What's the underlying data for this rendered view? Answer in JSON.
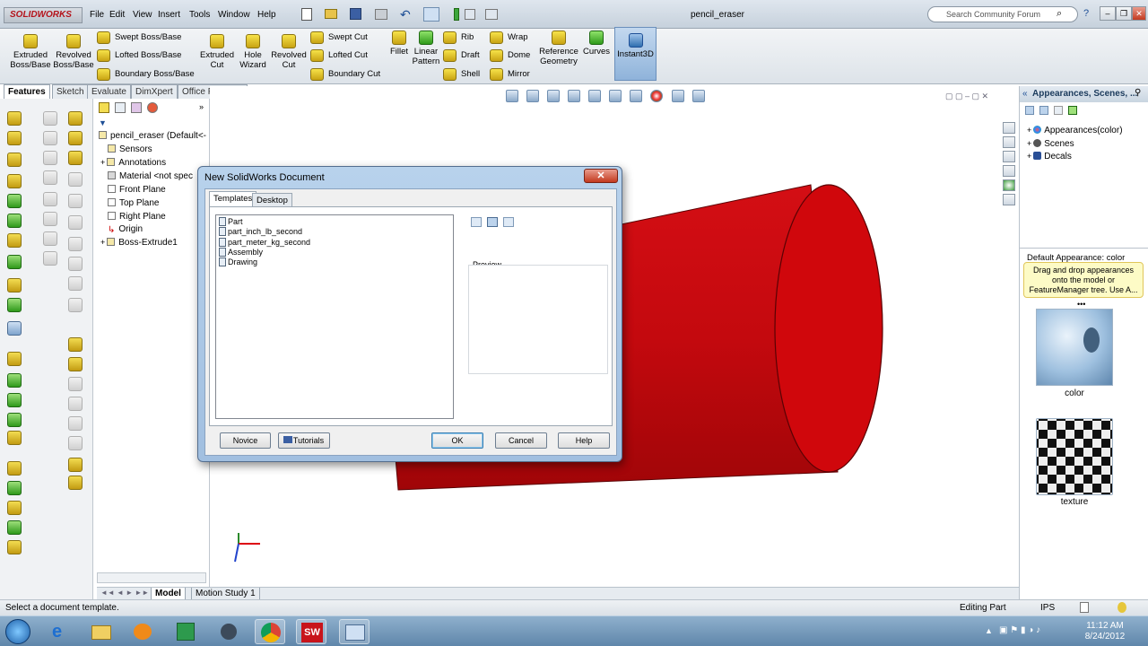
{
  "app": {
    "brand": "SOLIDWORKS",
    "document_title": "pencil_eraser",
    "menu": [
      "File",
      "Edit",
      "View",
      "Insert",
      "Tools",
      "Window",
      "Help"
    ],
    "search_placeholder": "Search Community Forum"
  },
  "command_manager": {
    "extruded_boss": "Extruded Boss/Base",
    "revolved_boss": "Revolved Boss/Base",
    "swept_boss": "Swept Boss/Base",
    "lofted_boss": "Lofted Boss/Base",
    "boundary_boss": "Boundary Boss/Base",
    "extruded_cut": "Extruded Cut",
    "hole_wizard": "Hole Wizard",
    "revolved_cut": "Revolved Cut",
    "swept_cut": "Swept Cut",
    "lofted_cut": "Lofted Cut",
    "boundary_cut": "Boundary Cut",
    "fillet": "Fillet",
    "linear_pattern": "Linear Pattern",
    "rib": "Rib",
    "draft": "Draft",
    "shell": "Shell",
    "wrap": "Wrap",
    "dome": "Dome",
    "mirror": "Mirror",
    "reference_geometry": "Reference Geometry",
    "curves": "Curves",
    "instant3d": "Instant3D"
  },
  "feature_tabs": [
    "Features",
    "Sketch",
    "Evaluate",
    "DimXpert",
    "Office Products"
  ],
  "feature_tree": {
    "root": "pencil_eraser  (Default<-",
    "items": [
      "Sensors",
      "Annotations",
      "Material <not spec",
      "Front Plane",
      "Top Plane",
      "Right Plane",
      "Origin",
      "Boss-Extrude1"
    ]
  },
  "dialog": {
    "title": "New SolidWorks Document",
    "close": "✕",
    "tabs": [
      "Templates",
      "Desktop"
    ],
    "templates": [
      "Part",
      "part_inch_lb_second",
      "part_meter_kg_second",
      "Assembly",
      "Drawing"
    ],
    "preview_label": "Preview",
    "buttons": {
      "novice": "Novice",
      "tutorials": "Tutorials",
      "ok": "OK",
      "cancel": "Cancel",
      "help": "Help"
    }
  },
  "task_pane": {
    "title": "Appearances, Scenes, ...",
    "tree": [
      "Appearances(color)",
      "Scenes",
      "Decals"
    ],
    "default_appearance": "Default Appearance: color",
    "tip": "Drag and drop appearances onto the model or FeatureManager tree.  Use A...",
    "swatches": [
      "color",
      "texture"
    ]
  },
  "bottom_tabs": [
    "Model",
    "Motion Study 1"
  ],
  "status": {
    "left": "Select a document template.",
    "mode": "Editing Part",
    "units": "IPS"
  },
  "taskbar": {
    "time": "11:12 AM",
    "date": "8/24/2012"
  },
  "colors": {
    "model_red": "#d00d12",
    "dialog_frame": "#a9c5e3",
    "accent": "#2f6fb0"
  }
}
